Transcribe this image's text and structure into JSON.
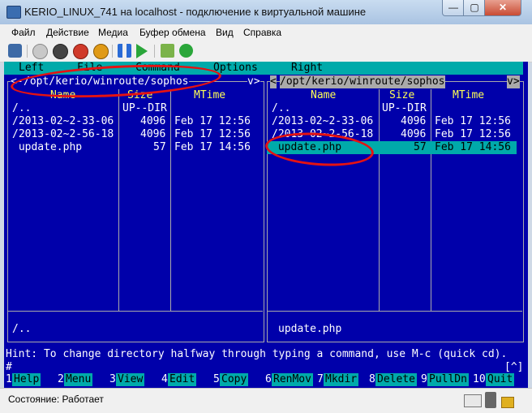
{
  "window": {
    "title": "KERIO_LINUX_741 на localhost - подключение к виртуальной машине",
    "min": "—",
    "max": "▢",
    "close": "✕"
  },
  "menu": [
    "Файл",
    "Действие",
    "Медиа",
    "Буфер обмена",
    "Вид",
    "Справка"
  ],
  "toolbar_icons": [
    "ctrl-alt-del-icon",
    "start-icon",
    "stop-icon",
    "shutdown-icon",
    "power-icon",
    "pause-icon",
    "play-icon",
    "snapshot-icon",
    "revert-icon"
  ],
  "mc": {
    "topmenu": [
      "Left",
      "File",
      "Command",
      "Options",
      "Right"
    ],
    "left_panel": {
      "path": "/opt/kerio/winroute/sophos",
      "path_prefix": "<-",
      "path_suffix": "v>",
      "col_name": "Name",
      "col_size": "Size",
      "col_mtime": "MTime",
      "rows": [
        {
          "name": "/..",
          "size": "UP--DIR",
          "mtime": ""
        },
        {
          "name": "/2013-02~2-33-06",
          "size": "4096",
          "mtime": "Feb 17 12:56"
        },
        {
          "name": "/2013-02~2-56-18",
          "size": "4096",
          "mtime": "Feb 17 12:56"
        },
        {
          "name": " update.php",
          "size": "57",
          "mtime": "Feb 17 14:56"
        }
      ],
      "mini_status": "/.."
    },
    "right_panel": {
      "path": "/opt/kerio/winroute/sophos",
      "path_prefix": "<",
      "path_suffix": "v>",
      "col_name": "Name",
      "col_size": "Size",
      "col_mtime": "MTime",
      "rows": [
        {
          "name": "/..",
          "size": "UP--DIR",
          "mtime": ""
        },
        {
          "name": "/2013-02~2-33-06",
          "size": "4096",
          "mtime": "Feb 17 12:56"
        },
        {
          "name": "/2013-02~2-56-18",
          "size": "4096",
          "mtime": "Feb 17 12:56"
        },
        {
          "name": " update.php",
          "size": "57",
          "mtime": "Feb 17 14:56"
        }
      ],
      "mini_status": "update.php"
    },
    "hint": "Hint: To change directory halfway through typing a command, use M-c (quick cd).",
    "prompt": "#",
    "prompt_right": "[^]",
    "fkeys": [
      {
        "num": "1",
        "label": "Help"
      },
      {
        "num": "2",
        "label": "Menu"
      },
      {
        "num": "3",
        "label": "View"
      },
      {
        "num": "4",
        "label": "Edit"
      },
      {
        "num": "5",
        "label": "Copy"
      },
      {
        "num": "6",
        "label": "RenMov"
      },
      {
        "num": "7",
        "label": "Mkdir"
      },
      {
        "num": "8",
        "label": "Delete"
      },
      {
        "num": "9",
        "label": "PullDn"
      },
      {
        "num": "10",
        "label": "Quit"
      }
    ]
  },
  "status": {
    "text": "Состояние: Работает"
  },
  "colors": {
    "term_bg": "#0000aa",
    "cyan": "#00aaaa",
    "yellow": "#ffff55",
    "annotation": "#e51212"
  }
}
